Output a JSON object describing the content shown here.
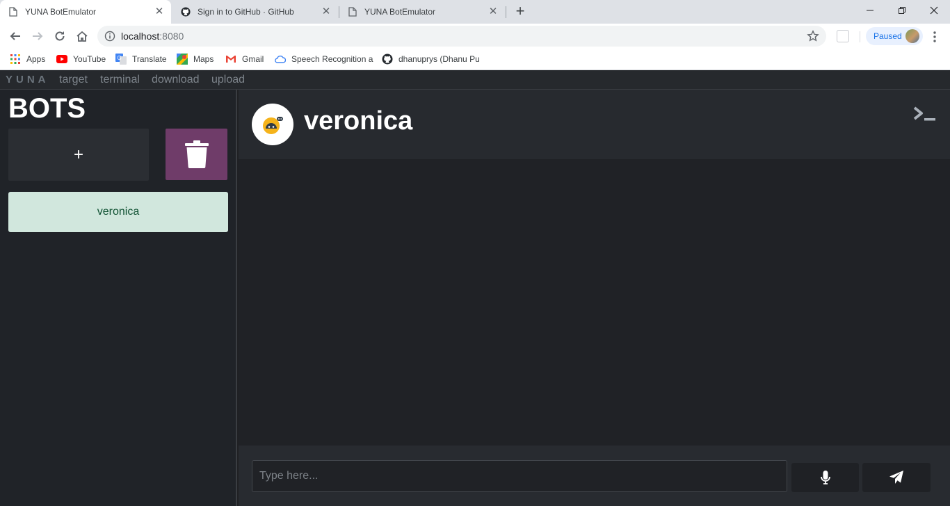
{
  "browser": {
    "tabs": [
      {
        "title": "YUNA BotEmulator",
        "icon": "page-icon",
        "active": true
      },
      {
        "title": "Sign in to GitHub · GitHub",
        "icon": "github-icon",
        "active": false
      },
      {
        "title": "YUNA BotEmulator",
        "icon": "page-icon",
        "active": false
      }
    ],
    "url_host": "localhost",
    "url_port": ":8080",
    "profile_status": "Paused",
    "bookmarks": [
      {
        "label": "Apps",
        "icon": "apps-grid-icon"
      },
      {
        "label": "YouTube",
        "icon": "youtube-icon"
      },
      {
        "label": "Translate",
        "icon": "translate-icon"
      },
      {
        "label": "Maps",
        "icon": "maps-icon"
      },
      {
        "label": "Gmail",
        "icon": "gmail-icon"
      },
      {
        "label": "Speech Recognition a",
        "icon": "cloud-icon"
      },
      {
        "label": "dhanuprys (Dhanu Pu",
        "icon": "github-icon"
      }
    ]
  },
  "app": {
    "brand": "YUNA",
    "nav": [
      "target",
      "terminal",
      "download",
      "upload"
    ],
    "sidebar": {
      "title": "BOTS",
      "add_label": "+",
      "bots": [
        "veronica"
      ]
    },
    "chat": {
      "bot_name": "veronica",
      "input_placeholder": "Type here..."
    },
    "colors": {
      "delete_button": "#6f3c69",
      "selected_bot_bg": "#d1e7dd",
      "selected_bot_text": "#0f5132"
    }
  }
}
